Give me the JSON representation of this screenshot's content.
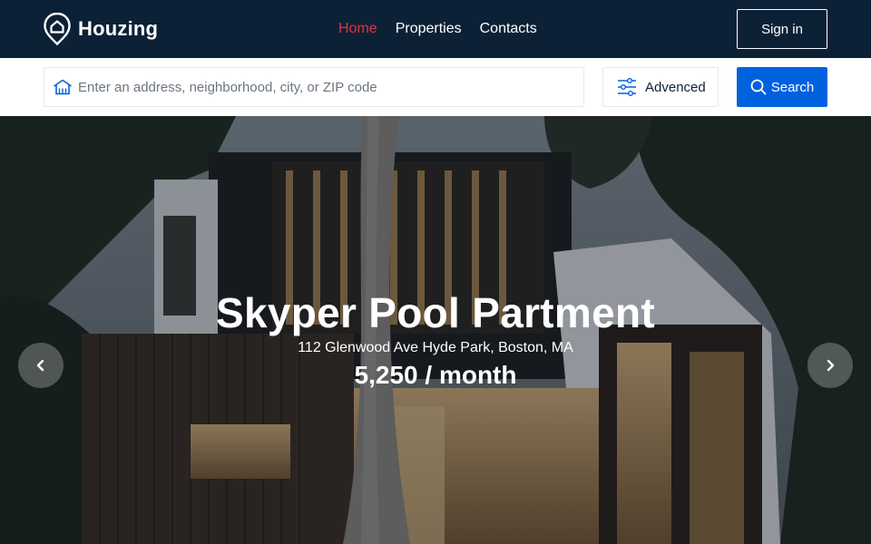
{
  "navbar": {
    "logo_text": "Houzing",
    "links": [
      {
        "label": "Home",
        "active": true
      },
      {
        "label": "Properties",
        "active": false
      },
      {
        "label": "Contacts",
        "active": false
      }
    ],
    "signin_label": "Sign in"
  },
  "search": {
    "placeholder": "Enter an address, neighborhood, city, or ZIP code",
    "value": "",
    "advanced_label": "Advenced",
    "search_label": "Search"
  },
  "hero": {
    "title": "Skyper Pool Partment",
    "address": "112 Glenwood Ave Hyde Park, Boston, MA",
    "price": "5,250 / month",
    "prev_icon": "chevron-left-icon",
    "next_icon": "chevron-right-icon"
  },
  "colors": {
    "navbar_bg": "#0d2136",
    "active_link": "#e2343a",
    "primary_button": "#0061df"
  }
}
